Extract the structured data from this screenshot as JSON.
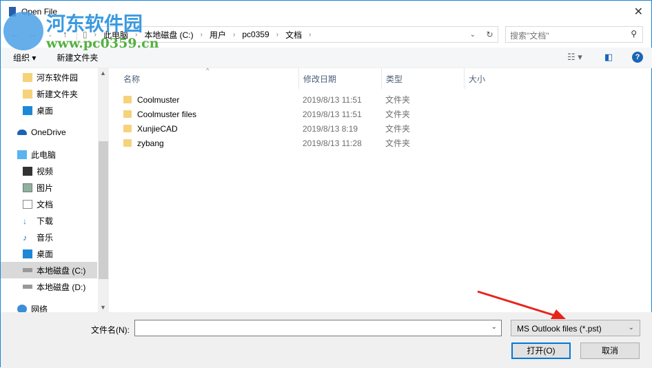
{
  "window": {
    "title": "Open File"
  },
  "watermark": {
    "name": "河东软件园",
    "url": "www.pc0359.cn"
  },
  "address": {
    "crumbs": [
      "此电脑",
      "本地磁盘 (C:)",
      "用户",
      "pc0359",
      "文档"
    ],
    "search_placeholder": "搜索\"文档\""
  },
  "toolbar": {
    "organize": "组织 ▾",
    "new_folder": "新建文件夹",
    "help": "?"
  },
  "sidebar": {
    "items": [
      {
        "label": "河东软件园",
        "icon": "folder-icon"
      },
      {
        "label": "新建文件夹",
        "icon": "folder-icon"
      },
      {
        "label": "桌面",
        "icon": "desktop-icon"
      },
      {
        "label": "OneDrive",
        "icon": "cloud-icon"
      },
      {
        "label": "此电脑",
        "icon": "computer-icon"
      },
      {
        "label": "视频",
        "icon": "video-icon"
      },
      {
        "label": "图片",
        "icon": "pictures-icon"
      },
      {
        "label": "文档",
        "icon": "documents-icon"
      },
      {
        "label": "下载",
        "icon": "download-icon"
      },
      {
        "label": "音乐",
        "icon": "music-icon"
      },
      {
        "label": "桌面",
        "icon": "desktop-icon"
      },
      {
        "label": "本地磁盘 (C:)",
        "icon": "drive-icon",
        "selected": true
      },
      {
        "label": "本地磁盘 (D:)",
        "icon": "drive-icon"
      },
      {
        "label": "网络",
        "icon": "network-icon"
      }
    ]
  },
  "columns": [
    "名称",
    "修改日期",
    "类型",
    "大小"
  ],
  "files": [
    {
      "name": "Coolmuster",
      "date": "2019/8/13 11:51",
      "type": "文件夹"
    },
    {
      "name": "Coolmuster files",
      "date": "2019/8/13 11:51",
      "type": "文件夹"
    },
    {
      "name": "XunjieCAD",
      "date": "2019/8/13 8:19",
      "type": "文件夹"
    },
    {
      "name": "zybang",
      "date": "2019/8/13 11:28",
      "type": "文件夹"
    }
  ],
  "bottom": {
    "filename_label": "文件名(N):",
    "filename_value": "",
    "filetype": "MS Outlook files (*.pst)",
    "open": "打开(O)",
    "cancel": "取消"
  },
  "colors": {
    "accent": "#0078d7",
    "arrow": "#e8231b"
  }
}
